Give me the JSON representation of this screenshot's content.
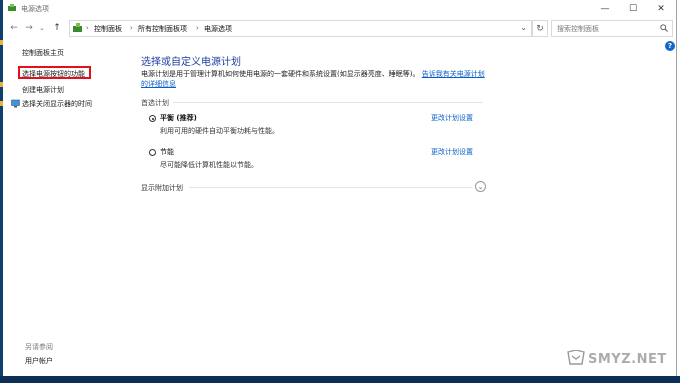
{
  "window": {
    "title": "电源选项",
    "minimize": "—",
    "maximize": "☐",
    "close": "✕"
  },
  "nav": {
    "back": "←",
    "forward": "→",
    "recent": "⌄",
    "up": "↑"
  },
  "address": {
    "crumbs": [
      "控制面板",
      "所有控制面板项",
      "电源选项"
    ],
    "sep": "›",
    "dropdown": "⌄",
    "refresh": "↻"
  },
  "search": {
    "placeholder": "搜索控制面板"
  },
  "sidebar": {
    "home": "控制面板主页",
    "items": [
      "选择电源按钮的功能",
      "创建电源计划",
      "选择关闭显示器的时间"
    ],
    "see_also": "另请参阅",
    "user_accounts": "用户帐户"
  },
  "main": {
    "title": "选择或自定义电源计划",
    "description": "电源计划是用于管理计算机如何使用电源的一套硬件和系统设置(如显示器亮度、睡眠等)。",
    "learn_more": "告诉我有关电源计划的详细信息",
    "preferred_section": "首选计划",
    "plans": [
      {
        "name": "平衡 (推荐)",
        "desc": "利用可用的硬件自动平衡功耗与性能。",
        "link": "更改计划设置",
        "selected": true
      },
      {
        "name": "节能",
        "desc": "尽可能降低计算机性能以节能。",
        "link": "更改计划设置",
        "selected": false
      }
    ],
    "more_plans": "显示附加计划",
    "expand_glyph": "⌄"
  },
  "help": "?",
  "watermark": "SMYZ.NET",
  "colors": {
    "accent": "#1f3f9e",
    "link": "#0a5ec8",
    "highlight": "#e0101c"
  }
}
